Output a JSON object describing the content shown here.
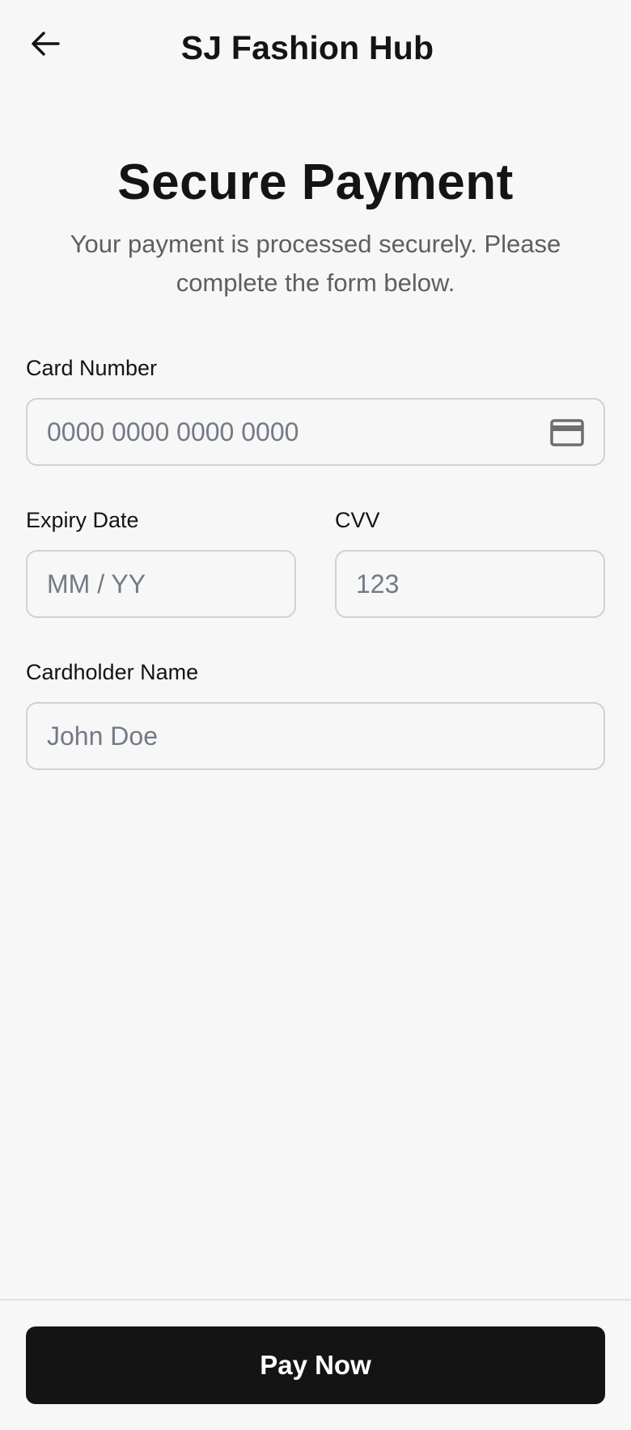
{
  "header": {
    "back_icon": "arrow-left-icon",
    "title": "SJ Fashion Hub"
  },
  "intro": {
    "title": "Secure Payment",
    "subtitle": "Your payment is processed securely. Please complete the form below."
  },
  "form": {
    "card_number": {
      "label": "Card Number",
      "value": "",
      "placeholder": "0000 0000 0000 0000",
      "icon": "credit-card-icon"
    },
    "expiry": {
      "label": "Expiry Date",
      "value": "",
      "placeholder": "MM / YY"
    },
    "cvv": {
      "label": "CVV",
      "value": "",
      "placeholder": "123"
    },
    "cardholder": {
      "label": "Cardholder Name",
      "value": "",
      "placeholder": "John Doe"
    }
  },
  "footer": {
    "pay_label": "Pay Now"
  },
  "colors": {
    "background": "#f7f7f7",
    "primary": "#141414",
    "subtitle_text": "#5f5f5f",
    "placeholder_text": "#737a86",
    "input_border": "#d1d1d1"
  }
}
